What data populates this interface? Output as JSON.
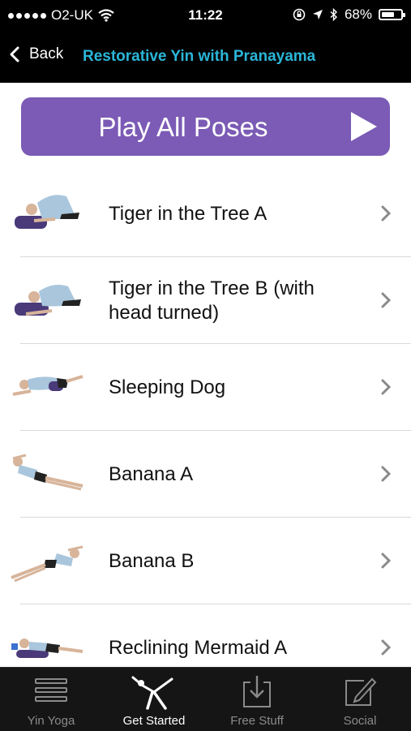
{
  "status": {
    "carrier": "O2-UK",
    "time": "11:22",
    "battery": "68%",
    "battery_level": 0.68
  },
  "nav": {
    "back_label": "Back",
    "title": "Restorative Yin with Pranayama"
  },
  "play_all": {
    "label": "Play All Poses"
  },
  "poses": [
    {
      "name": "Tiger in the Tree A"
    },
    {
      "name": "Tiger in the Tree B (with head turned)"
    },
    {
      "name": "Sleeping Dog"
    },
    {
      "name": "Banana A"
    },
    {
      "name": "Banana B"
    },
    {
      "name": "Reclining Mermaid A"
    }
  ],
  "tabs": [
    {
      "label": "Yin Yoga",
      "icon": "list-icon",
      "active": false
    },
    {
      "label": "Get Started",
      "icon": "yoga-pose-icon",
      "active": true
    },
    {
      "label": "Free Stuff",
      "icon": "download-icon",
      "active": false
    },
    {
      "label": "Social",
      "icon": "compose-icon",
      "active": false
    }
  ],
  "colors": {
    "accent": "#2bb6d8",
    "button": "#7b5bb5",
    "tabbar": "#151515"
  }
}
